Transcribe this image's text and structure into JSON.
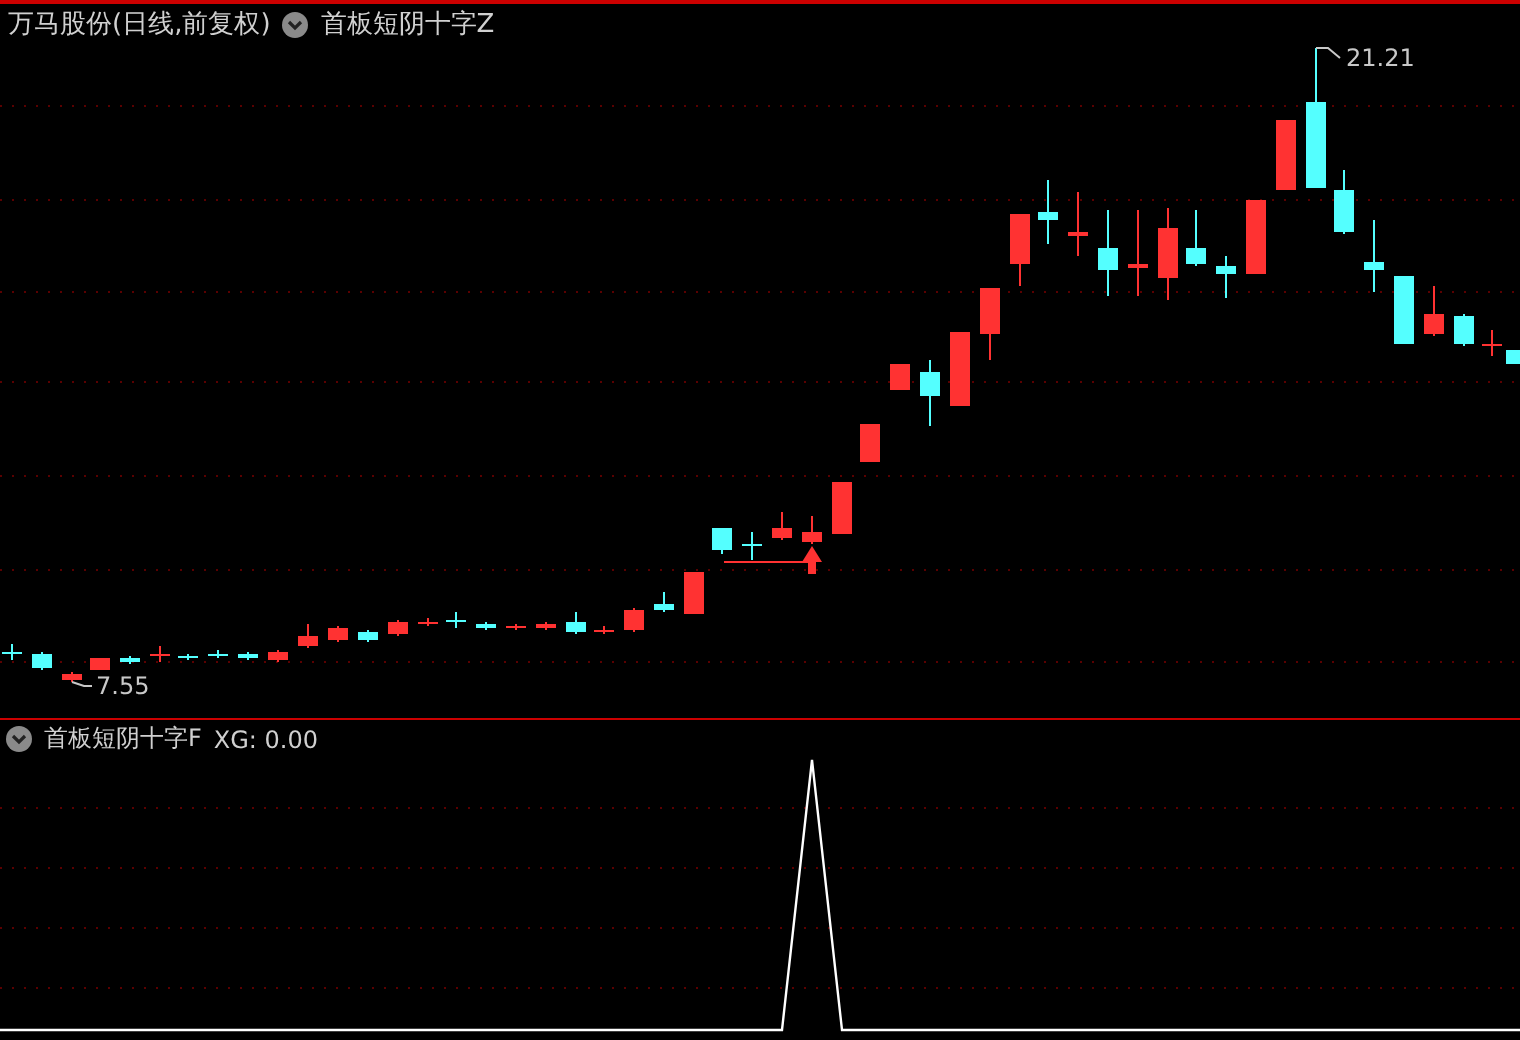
{
  "header": {
    "stock": "万马股份(日线,前复权)",
    "indicator": "首板短阴十字Z"
  },
  "main_chart": {
    "high_label": "21.21",
    "low_label": "7.55"
  },
  "sub_panel": {
    "indicator": "首板短阴十字F",
    "reading": "XG: 0.00"
  }
}
